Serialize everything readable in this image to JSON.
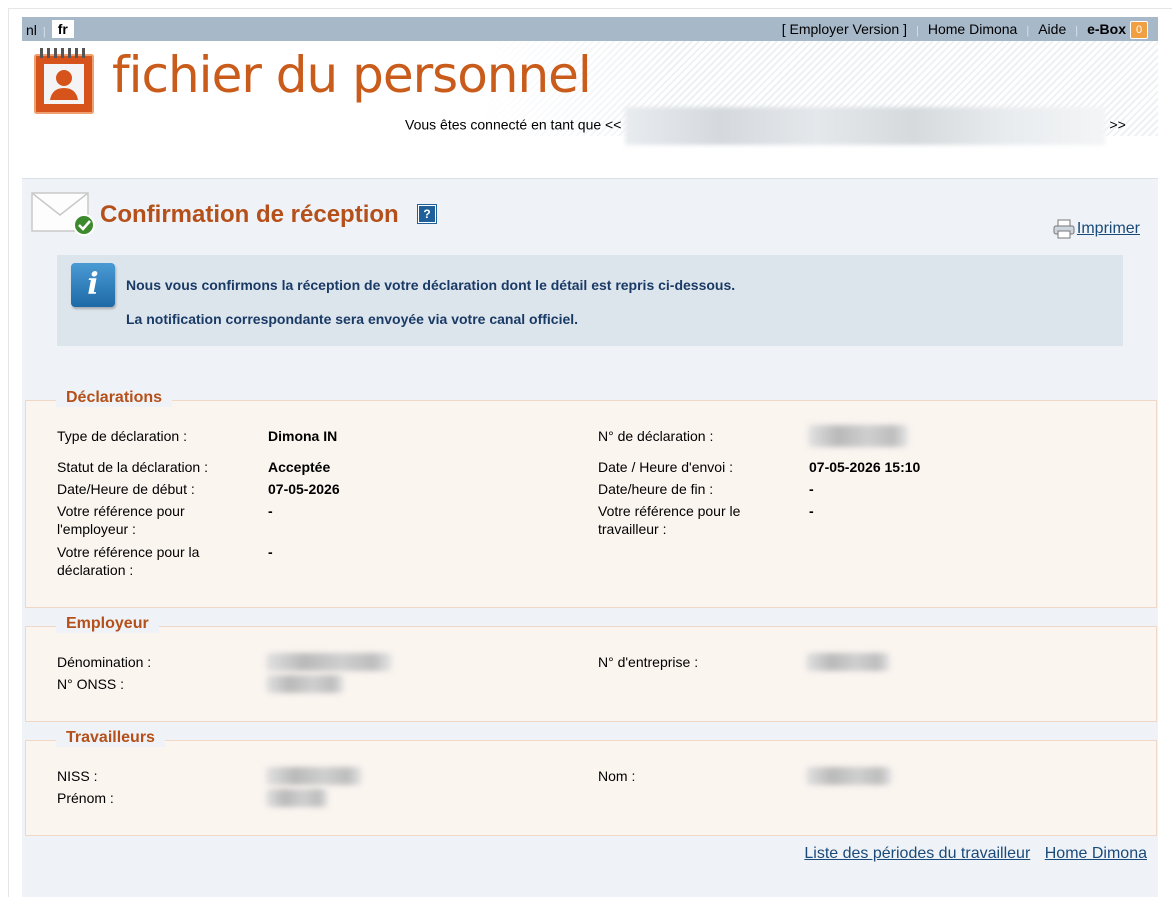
{
  "topbar": {
    "lang_nl": "nl",
    "lang_fr": "fr",
    "employer_version": "[ Employer Version ]",
    "home_dimona": "Home Dimona",
    "aide": "Aide",
    "ebox": "e-Box",
    "ebox_count": "0"
  },
  "banner": {
    "logo_text": "fichier du personnel",
    "connected_prefix": "Vous êtes connecté en tant que <<",
    "connected_suffix": ">>"
  },
  "header": {
    "title": "Confirmation de réception",
    "help": "?",
    "print_label": "Imprimer"
  },
  "info": {
    "icon_letter": "i",
    "line1": "Nous vous confirmons la réception de votre déclaration dont le détail est repris ci-dessous.",
    "line2": "La notification correspondante sera envoyée via votre canal officiel."
  },
  "declarations": {
    "legend": "Déclarations",
    "type_label": "Type de déclaration :",
    "type_value": "Dimona IN",
    "num_label": "N° de déclaration :",
    "status_label": "Statut de la déclaration :",
    "status_value": "Acceptée",
    "send_label": "Date / Heure d'envoi :",
    "send_value": "07-05-2026 15:10",
    "start_label": "Date/Heure de début :",
    "start_value": "07-05-2026",
    "end_label": "Date/heure de fin :",
    "end_value": "-",
    "ref_employer_label_1": "Votre référence pour",
    "ref_employer_label_2": "l'employeur :",
    "ref_employer_value": "-",
    "ref_worker_label_1": "Votre référence pour le",
    "ref_worker_label_2": "travailleur :",
    "ref_worker_value": "-",
    "ref_decl_label_1": "Votre référence pour la",
    "ref_decl_label_2": "déclaration :",
    "ref_decl_value": "-"
  },
  "employer": {
    "legend": "Employeur",
    "name_label": "Dénomination :",
    "company_label": "N° d'entreprise :",
    "onss_label": "N° ONSS :"
  },
  "workers": {
    "legend": "Travailleurs",
    "niss_label": "NISS :",
    "nom_label": "Nom :",
    "prenom_label": "Prénom :"
  },
  "footer": {
    "periods_link": "Liste des périodes du travailleur",
    "home_link": "Home Dimona"
  }
}
